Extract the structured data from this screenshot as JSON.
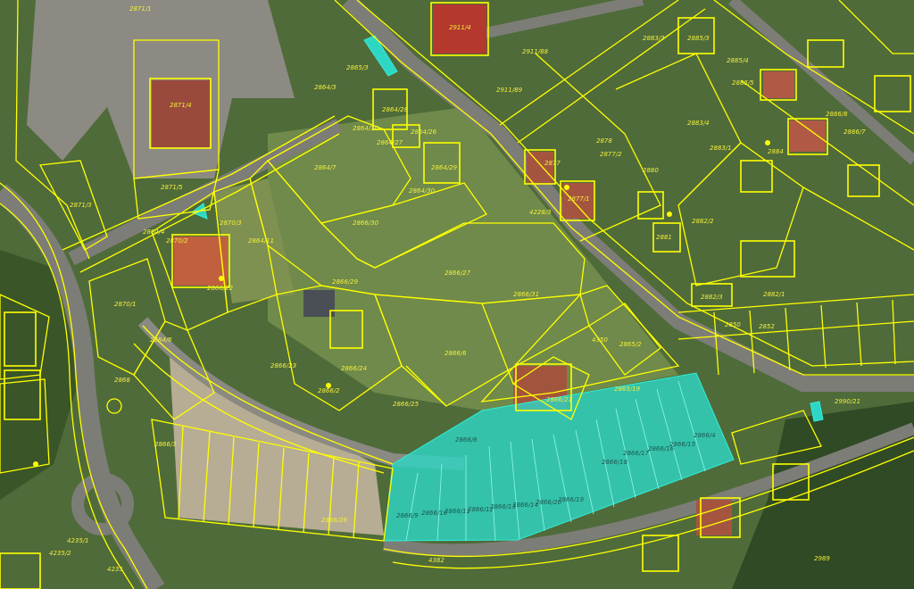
{
  "map": {
    "highlight_color": "#2ed6c4",
    "boundary_color": "#ffff00",
    "parcel_labels": [
      "2871/1",
      "2871/4",
      "2871/5",
      "2871/3",
      "2864/3",
      "2865/3",
      "2864/28",
      "2864/27",
      "2864/26",
      "2864/29",
      "2864/30",
      "2864/10",
      "2864/7",
      "2866/30",
      "2870/3",
      "2864/11",
      "2864/4",
      "2870/2",
      "2866/22",
      "2866/29",
      "2866/27",
      "2866/31",
      "2870/1",
      "2864/6",
      "2866/24",
      "2866/23",
      "2866/2",
      "2866/6",
      "2866/25",
      "2868",
      "2866/3",
      "4228/3",
      "2911/4",
      "2911/88",
      "2911/89",
      "2878",
      "2877/2",
      "2877",
      "2877/1",
      "2880",
      "2883/3",
      "2883/4",
      "2885/3",
      "2885/4",
      "2885/5",
      "2886/8",
      "2886/7",
      "2883/1",
      "2884",
      "2882/2",
      "2881",
      "2882/1",
      "2882/3",
      "2852",
      "2850",
      "2865/2",
      "4350",
      "2865/19",
      "2866/21",
      "2866/4",
      "2866/15",
      "2866/16",
      "2866/17",
      "2866/18",
      "2866/19",
      "2866/20",
      "2866/14",
      "2866/13",
      "2866/12",
      "2866/11",
      "2866/10",
      "2866/9",
      "2866/8",
      "2866/26",
      "4235/1",
      "4235/2",
      "4235",
      "4382",
      "2989",
      "2990/21"
    ]
  }
}
